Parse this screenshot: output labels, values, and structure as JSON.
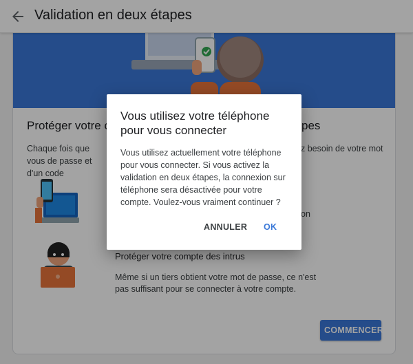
{
  "header": {
    "title": "Validation en deux étapes",
    "back_icon": "arrow-back-icon"
  },
  "page": {
    "section_title_start": "Protéger votre c",
    "section_title_end": "pes",
    "intro_left": "Chaque fois que vous de passe et d'un code",
    "intro_right": "z besoin de votre mot",
    "feature1_tail": "on",
    "feature2_title": "Protéger votre compte des intrus",
    "feature2_desc": "Même si un tiers obtient votre mot de passe, ce n'est pas suffisant pour se connecter à votre compte.",
    "start_button": "COMMENCER"
  },
  "dialog": {
    "title": "Vous utilisez votre téléphone pour vous connecter",
    "body": "Vous utilisez actuellement votre téléphone pour vous connecter. Si vous activez la validation en deux étapes, la connexion sur téléphone sera désactivée pour votre compte. Voulez-vous vraiment continuer ?",
    "cancel_label": "ANNULER",
    "ok_label": "OK"
  },
  "colors": {
    "accent": "#3a78d8",
    "hero_bg": "#3a78d8",
    "scrim": "rgba(0,0,0,0.36)"
  }
}
